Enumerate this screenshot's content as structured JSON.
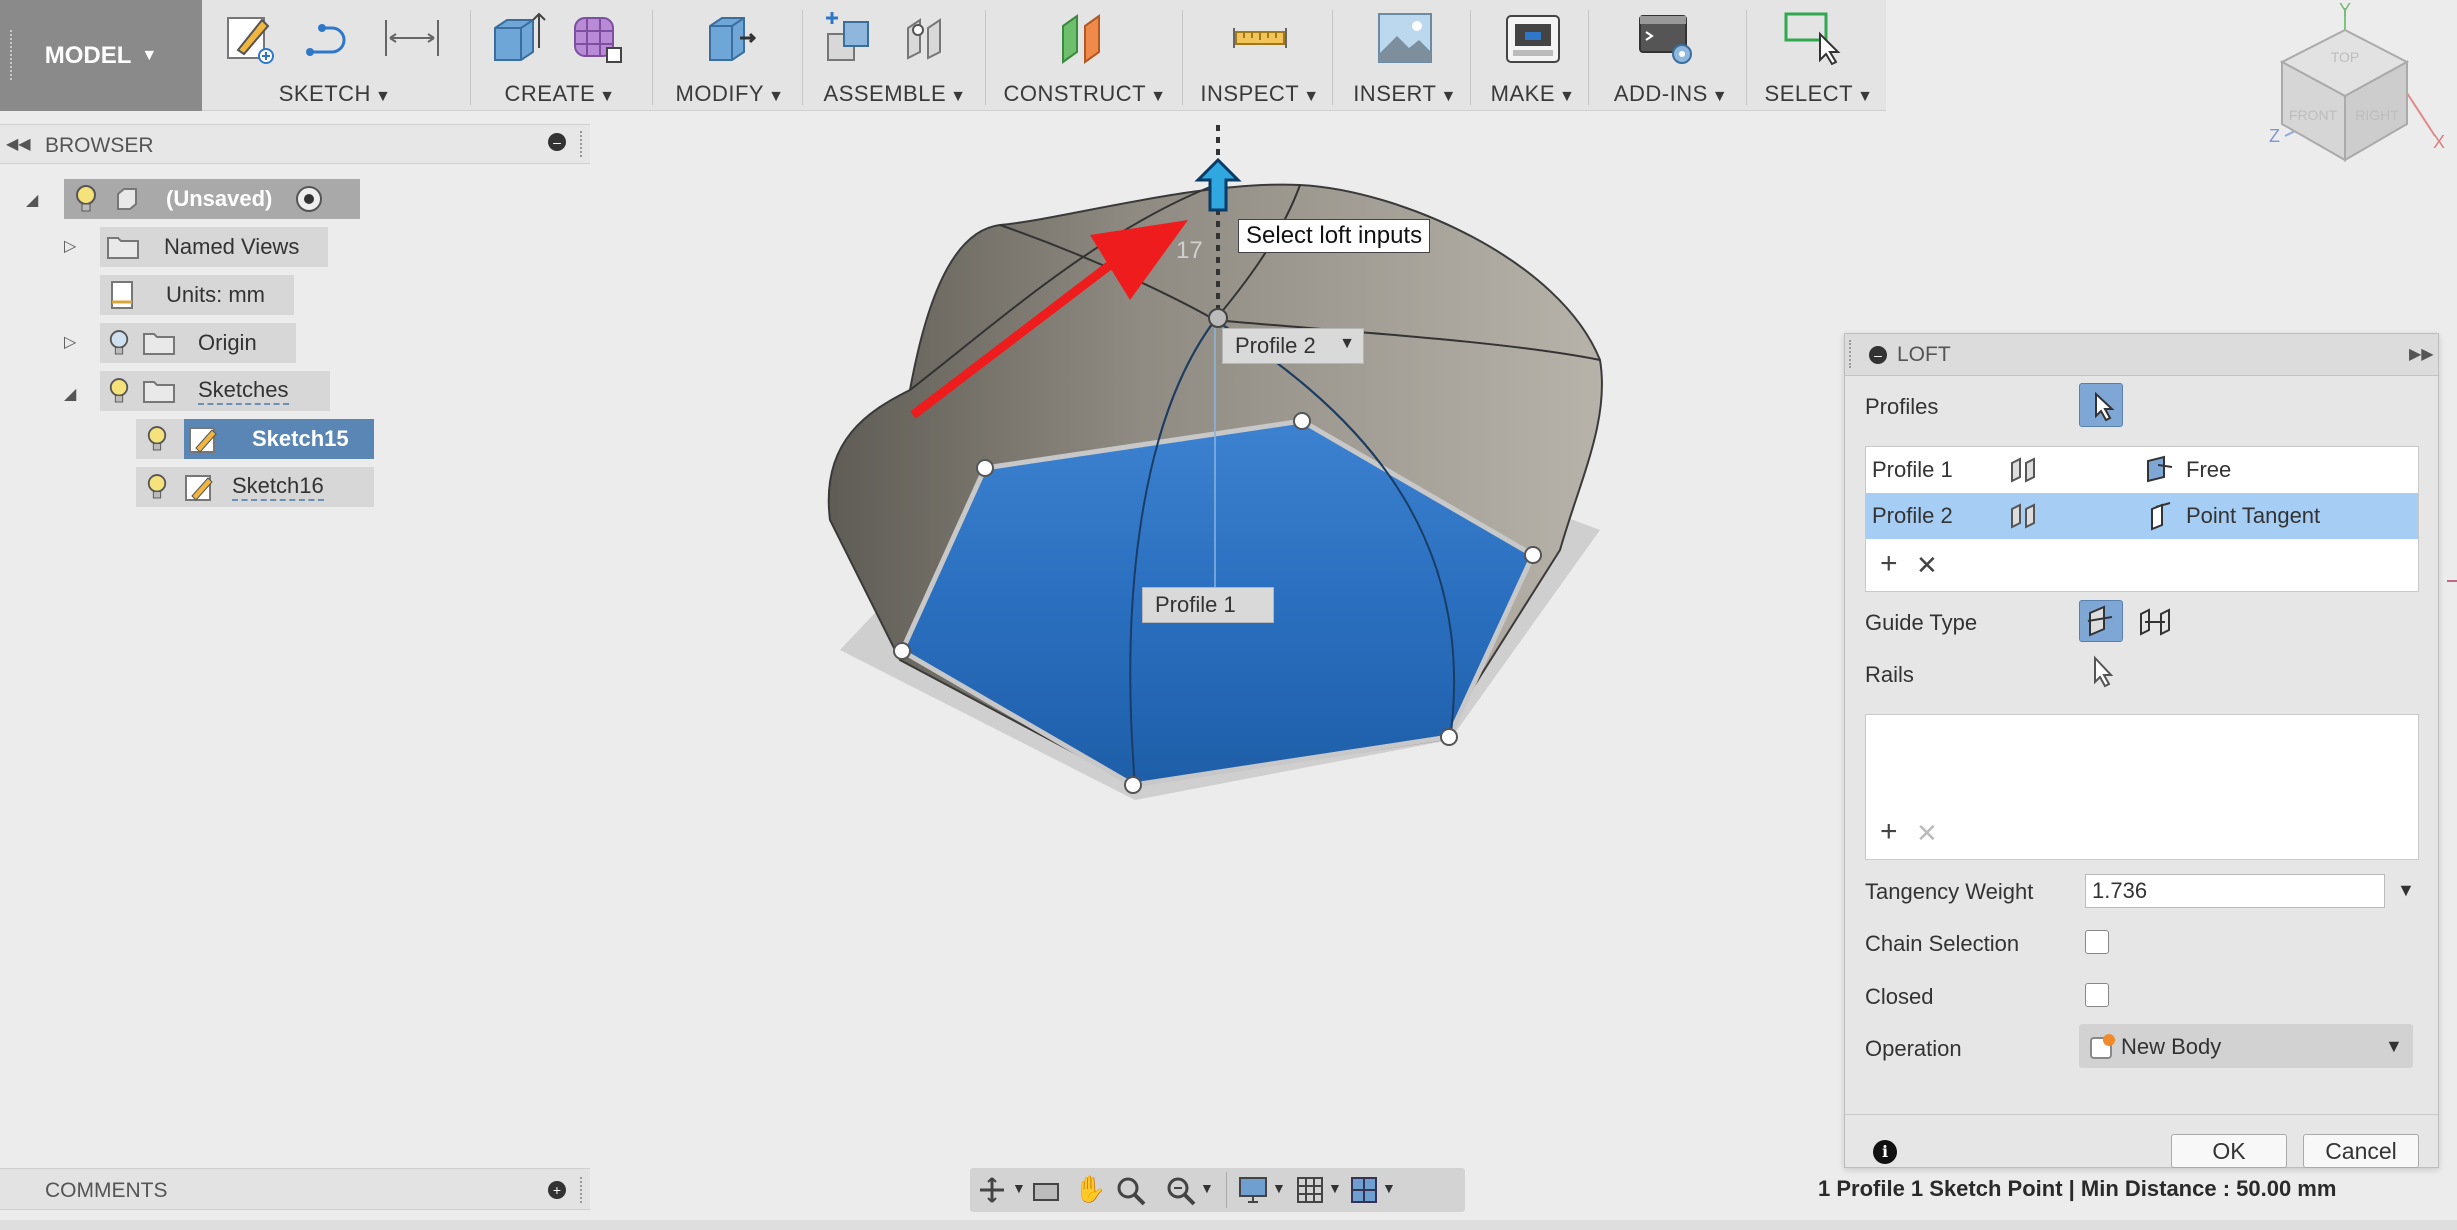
{
  "toolbar": {
    "model_label": "MODEL",
    "groups": [
      {
        "label": "SKETCH"
      },
      {
        "label": "CREATE"
      },
      {
        "label": "MODIFY"
      },
      {
        "label": "ASSEMBLE"
      },
      {
        "label": "CONSTRUCT"
      },
      {
        "label": "INSPECT"
      },
      {
        "label": "INSERT"
      },
      {
        "label": "MAKE"
      },
      {
        "label": "ADD-INS"
      },
      {
        "label": "SELECT"
      }
    ]
  },
  "browser": {
    "title": "BROWSER",
    "root": "(Unsaved)",
    "items": [
      {
        "label": "Named Views"
      },
      {
        "label": "Units: mm"
      },
      {
        "label": "Origin"
      },
      {
        "label": "Sketches"
      },
      {
        "label": "Sketch15"
      },
      {
        "label": "Sketch16"
      }
    ]
  },
  "comments": {
    "title": "COMMENTS"
  },
  "viewport": {
    "tooltip": "Select loft inputs",
    "profile2_label": "Profile 2",
    "profile1_label": "Profile 1",
    "dimension_partial": "17",
    "viewcube": {
      "top": "TOP",
      "front": "FRONT",
      "right": "RIGHT",
      "axis_z": "Z",
      "axis_x": "X",
      "axis_y": "Y"
    }
  },
  "loft": {
    "title": "LOFT",
    "profiles_label": "Profiles",
    "profiles": [
      {
        "name": "Profile 1",
        "condition": "Free"
      },
      {
        "name": "Profile 2",
        "condition": "Point Tangent"
      }
    ],
    "guide_type_label": "Guide Type",
    "rails_label": "Rails",
    "tangency_weight_label": "Tangency Weight",
    "tangency_weight_value": "1.736",
    "chain_selection_label": "Chain Selection",
    "closed_label": "Closed",
    "operation_label": "Operation",
    "operation_value": "New Body",
    "ok_label": "OK",
    "cancel_label": "Cancel"
  },
  "status": "1 Profile 1 Sketch Point | Min Distance : 50.00 mm",
  "colors": {
    "accent_blue": "#2f78c9",
    "selection_row": "#a6cdf4",
    "annotation_red": "#ee1c1c"
  }
}
